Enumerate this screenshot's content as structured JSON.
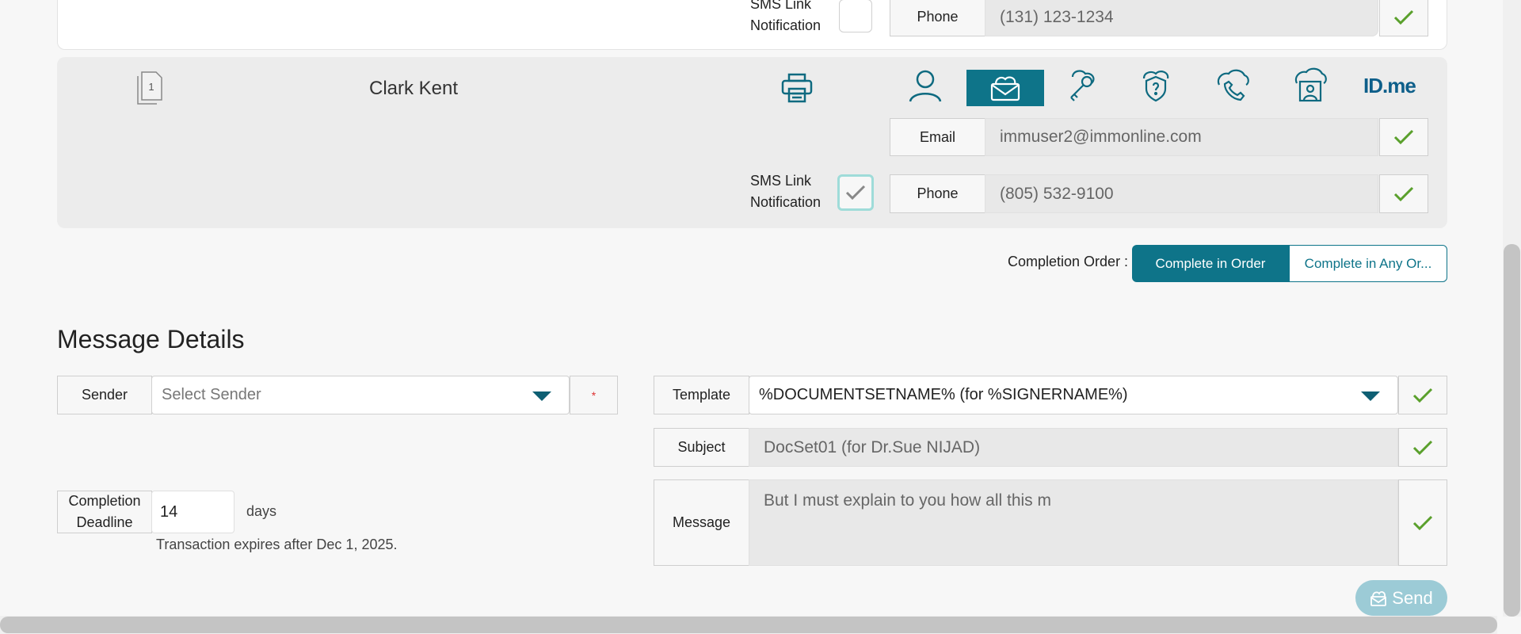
{
  "previous_signer": {
    "sms_label": "SMS Link Notification",
    "phone_label": "Phone",
    "phone_value": "(131) 123-1234"
  },
  "signer": {
    "doc_badge": "1",
    "name": "Clark Kent",
    "tabs": [
      "printer-icon",
      "person-icon",
      "envelope-icon",
      "key-icon",
      "shield-question-icon",
      "phone-cloud-icon",
      "id-cloud-icon"
    ],
    "idme_text": "ID.me",
    "email_label": "Email",
    "email_value": "immuser2@immonline.com",
    "sms_label": "SMS Link Notification",
    "sms_checked": true,
    "phone_label": "Phone",
    "phone_value": "(805) 532-9100"
  },
  "completion_order": {
    "label": "Completion Order :",
    "options": [
      "Complete in Order",
      "Complete in Any Or..."
    ],
    "selected": "Complete in Order"
  },
  "message_details": {
    "title": "Message Details",
    "sender_label": "Sender",
    "sender_placeholder": "Select Sender",
    "required_mark": "*",
    "template_label": "Template",
    "template_value": "%DOCUMENTSETNAME% (for %SIGNERNAME%)",
    "subject_label": "Subject",
    "subject_value": "DocSet01 (for Dr.Sue NIJAD)",
    "message_label": "Message",
    "message_value": "But I must explain to you how all this m",
    "deadline_label": "Completion Deadline",
    "deadline_value": "14",
    "deadline_unit": "days",
    "expires_text": "Transaction expires after Dec 1, 2025."
  },
  "send_label": "Send",
  "colors": {
    "accent": "#0e7489",
    "check": "#5aa02c",
    "send_bg": "#9ccbd6"
  }
}
